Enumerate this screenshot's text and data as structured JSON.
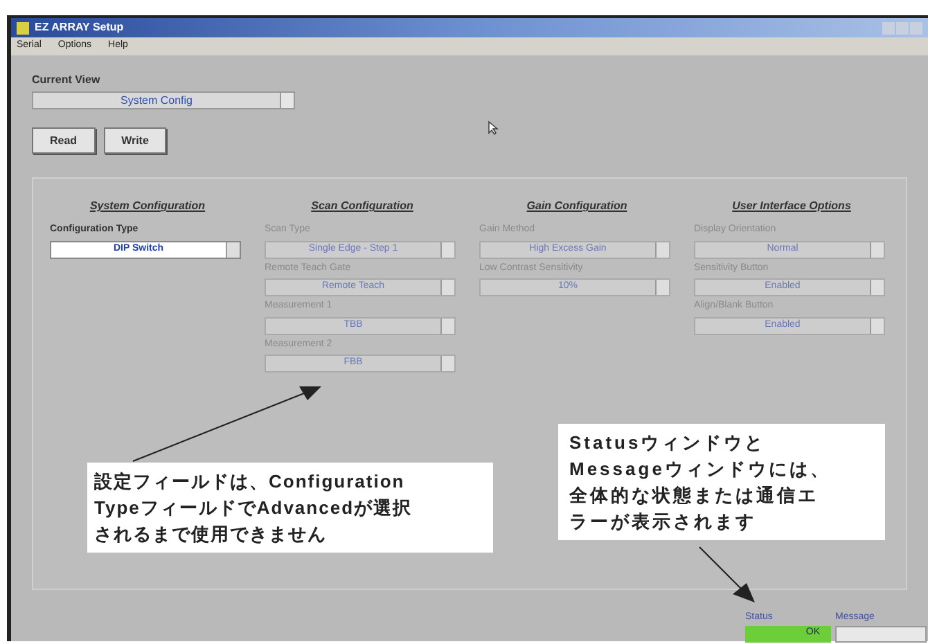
{
  "window": {
    "title": "EZ ARRAY Setup"
  },
  "menu": [
    "Serial",
    "Options",
    "Help"
  ],
  "current_view": {
    "label": "Current View",
    "value": "System Config"
  },
  "buttons": [
    "Read",
    "Write"
  ],
  "sections": [
    {
      "title": "System Configuration",
      "fields": [
        {
          "label": "Configuration Type",
          "value": "DIP Switch",
          "disabled": false
        }
      ]
    },
    {
      "title": "Scan Configuration",
      "fields": [
        {
          "label": "Scan Type",
          "value": "Single Edge - Step 1",
          "disabled": true
        },
        {
          "label": "Remote Teach Gate",
          "value": "Remote Teach",
          "disabled": true
        },
        {
          "label": "Measurement 1",
          "value": "TBB",
          "disabled": true
        },
        {
          "label": "Measurement 2",
          "value": "FBB",
          "disabled": true
        }
      ]
    },
    {
      "title": "Gain Configuration",
      "fields": [
        {
          "label": "Gain Method",
          "value": "High Excess Gain",
          "disabled": true
        },
        {
          "label": "Low Contrast Sensitivity",
          "value": "10%",
          "disabled": true
        }
      ]
    },
    {
      "title": "User Interface Options",
      "fields": [
        {
          "label": "Display Orientation",
          "value": "Normal",
          "disabled": true
        },
        {
          "label": "Sensitivity Button",
          "value": "Enabled",
          "disabled": true
        },
        {
          "label": "Align/Blank Button",
          "value": "Enabled",
          "disabled": true
        }
      ]
    }
  ],
  "callouts": [
    {
      "lines": [
        "設定フィールドは、Configuration",
        "TypeフィールドでAdvancedが選択",
        "されるまで使用できません"
      ]
    },
    {
      "lines": [
        "Statusウィンドウと",
        "Messageウィンドウには、",
        "全体的な状態または通信エ",
        "ラーが表示されます"
      ]
    }
  ],
  "status": {
    "label": "Status",
    "value": "OK"
  },
  "message": {
    "label": "Message"
  }
}
